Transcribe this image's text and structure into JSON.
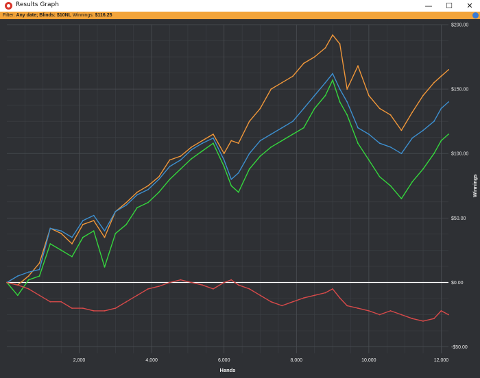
{
  "window": {
    "title": "Results Graph",
    "minimize_glyph": "—",
    "maximize_glyph": "☐",
    "close_glyph": "✕"
  },
  "filter": {
    "prefix": "Filter: ",
    "date": "Any date; ",
    "blinds": "Blinds: $10NL",
    "winnings_label": " Winnings: ",
    "winnings_value": "$116.25"
  },
  "colors": {
    "background": "#2e3034",
    "grid": "#4a4d52",
    "zero_line": "#ffffff",
    "filter_bar": "#f3a43a"
  },
  "chart_data": {
    "type": "line",
    "xlabel": "Hands",
    "ylabel": "Winnings",
    "xlim": [
      0,
      12200
    ],
    "ylim": [
      -55,
      200
    ],
    "x_ticks": [
      2000,
      4000,
      6000,
      8000,
      10000,
      12000
    ],
    "x_tick_labels": [
      "2,000",
      "4,000",
      "6,000",
      "8,000",
      "10,000",
      "12,000"
    ],
    "y_ticks": [
      200,
      150,
      100,
      50,
      0,
      -50
    ],
    "y_tick_labels": [
      "$200.00",
      "$150.00",
      "$100.00",
      "$50.00",
      "$0.00",
      "-$50.00"
    ],
    "grid": true,
    "series": [
      {
        "color": "#f0973a",
        "x": [
          0,
          300,
          600,
          900,
          1200,
          1500,
          1800,
          2100,
          2400,
          2700,
          3000,
          3300,
          3600,
          3900,
          4200,
          4500,
          4800,
          5100,
          5400,
          5700,
          6000,
          6200,
          6400,
          6700,
          7000,
          7300,
          7600,
          7900,
          8200,
          8500,
          8800,
          9000,
          9200,
          9400,
          9700,
          10000,
          10300,
          10600,
          10900,
          11200,
          11500,
          11800,
          12000,
          12200
        ],
        "y": [
          0,
          -2,
          5,
          15,
          42,
          38,
          30,
          45,
          48,
          35,
          55,
          62,
          70,
          75,
          82,
          95,
          98,
          105,
          110,
          115,
          100,
          110,
          108,
          125,
          135,
          150,
          155,
          160,
          170,
          175,
          182,
          192,
          185,
          150,
          168,
          145,
          135,
          130,
          118,
          132,
          145,
          155,
          160,
          165
        ]
      },
      {
        "color": "#3d8fcf",
        "x": [
          0,
          300,
          600,
          900,
          1200,
          1500,
          1800,
          2100,
          2400,
          2700,
          3000,
          3300,
          3600,
          3900,
          4200,
          4500,
          4800,
          5100,
          5400,
          5700,
          6000,
          6200,
          6400,
          6700,
          7000,
          7300,
          7600,
          7900,
          8200,
          8500,
          8800,
          9000,
          9200,
          9400,
          9700,
          10000,
          10300,
          10600,
          10900,
          11200,
          11500,
          11800,
          12000,
          12200
        ],
        "y": [
          0,
          5,
          8,
          10,
          42,
          40,
          35,
          48,
          52,
          40,
          55,
          60,
          68,
          72,
          80,
          90,
          95,
          103,
          108,
          112,
          95,
          80,
          85,
          100,
          110,
          115,
          120,
          125,
          135,
          145,
          155,
          162,
          150,
          140,
          120,
          115,
          108,
          105,
          100,
          112,
          118,
          125,
          135,
          140
        ]
      },
      {
        "color": "#35d63d",
        "x": [
          0,
          300,
          600,
          900,
          1200,
          1500,
          1800,
          2100,
          2400,
          2700,
          3000,
          3300,
          3600,
          3900,
          4200,
          4500,
          4800,
          5100,
          5400,
          5700,
          6000,
          6200,
          6400,
          6700,
          7000,
          7300,
          7600,
          7900,
          8200,
          8500,
          8800,
          9000,
          9200,
          9400,
          9700,
          10000,
          10300,
          10600,
          10900,
          11200,
          11500,
          11800,
          12000,
          12200
        ],
        "y": [
          0,
          -10,
          2,
          5,
          30,
          25,
          20,
          35,
          40,
          12,
          38,
          45,
          58,
          62,
          70,
          80,
          88,
          96,
          102,
          108,
          90,
          75,
          70,
          88,
          98,
          105,
          110,
          115,
          120,
          135,
          145,
          157,
          140,
          130,
          108,
          95,
          82,
          75,
          65,
          78,
          88,
          100,
          110,
          115
        ]
      },
      {
        "color": "#d94a4a",
        "x": [
          0,
          300,
          600,
          900,
          1200,
          1500,
          1800,
          2100,
          2400,
          2700,
          3000,
          3300,
          3600,
          3900,
          4200,
          4500,
          4800,
          5100,
          5400,
          5700,
          6000,
          6200,
          6400,
          6700,
          7000,
          7300,
          7600,
          7900,
          8200,
          8500,
          8800,
          9000,
          9200,
          9400,
          9700,
          10000,
          10300,
          10600,
          10900,
          11200,
          11500,
          11800,
          12000,
          12200
        ],
        "y": [
          0,
          -2,
          -5,
          -10,
          -15,
          -15,
          -20,
          -20,
          -22,
          -22,
          -20,
          -15,
          -10,
          -5,
          -3,
          0,
          2,
          0,
          -2,
          -5,
          0,
          2,
          -2,
          -5,
          -10,
          -15,
          -18,
          -15,
          -12,
          -10,
          -8,
          -5,
          -12,
          -18,
          -20,
          -22,
          -25,
          -22,
          -25,
          -28,
          -30,
          -28,
          -22,
          -25
        ]
      }
    ]
  }
}
